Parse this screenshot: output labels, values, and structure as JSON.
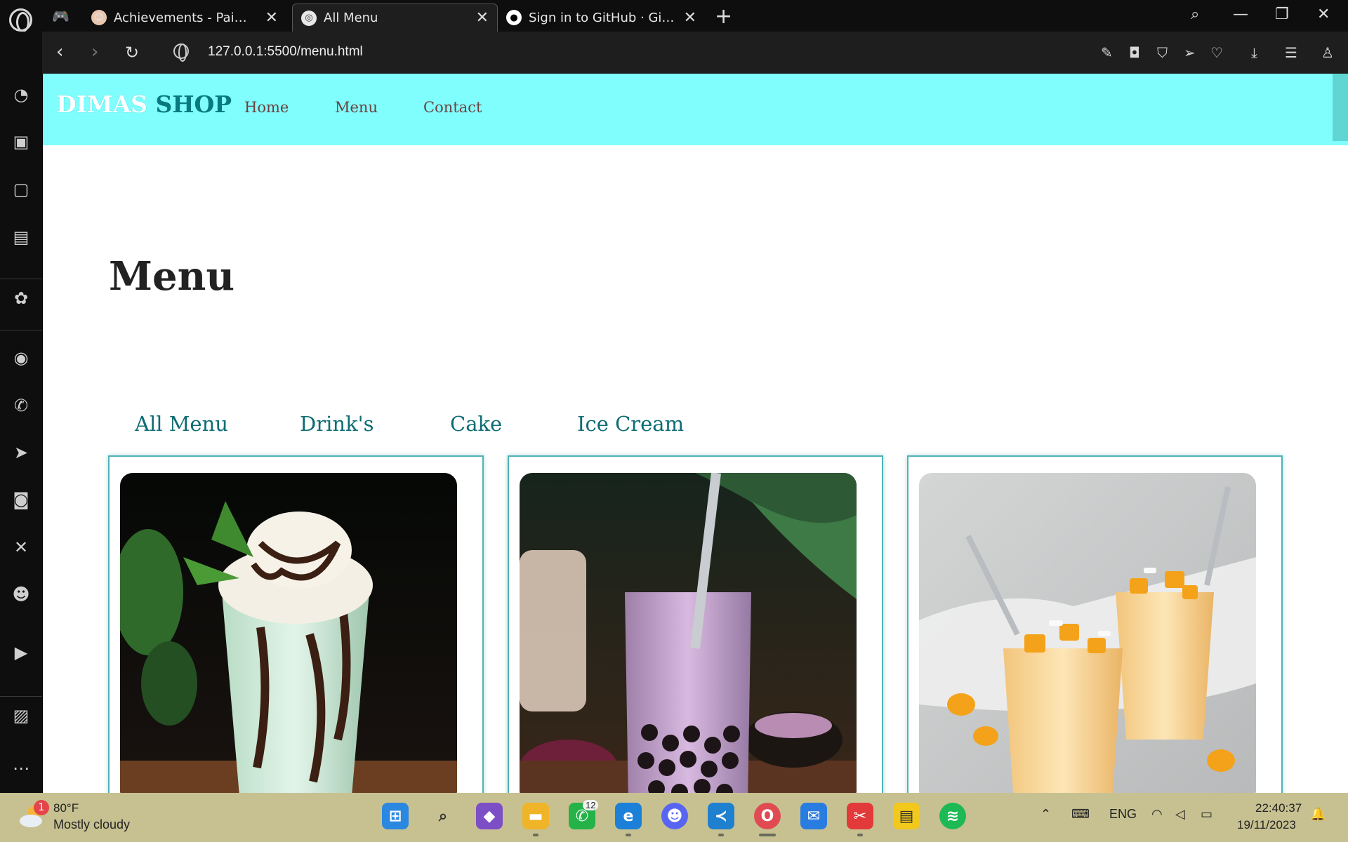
{
  "browser": {
    "tabs": [
      {
        "title": "Achievements - Paimon.moe",
        "active": false
      },
      {
        "title": "All Menu",
        "active": true
      },
      {
        "title": "Sign in to GitHub · GitHub",
        "active": false
      }
    ],
    "url": "127.0.0.1:5500/menu.html"
  },
  "site": {
    "brand_part1": "DIMAS",
    "brand_part2": "SHOP",
    "nav": [
      "Home",
      "Menu",
      "Contact"
    ],
    "page_title": "Menu",
    "categories": [
      "All Menu",
      "Drink's",
      "Cake",
      "Ice Cream"
    ],
    "accent_color": "#7ffefd",
    "brand_dark_color": "#08797e",
    "products": [
      {
        "image": "mint-chocolate-milkshake"
      },
      {
        "image": "taro-bubble-tea"
      },
      {
        "image": "mango-smoothies"
      }
    ]
  },
  "sidebar_icons": [
    "speed-dial-icon",
    "shop-icon",
    "twitch-icon",
    "cpu-icon",
    "chatgpt-icon",
    "messenger-icon",
    "whatsapp-icon",
    "telegram-icon",
    "instagram-icon",
    "x-icon",
    "discord-icon",
    "player-icon",
    "gallery-icon",
    "more-icon"
  ],
  "taskbar": {
    "weather_temp": "80°F",
    "weather_desc": "Mostly cloudy",
    "weather_badge": "1",
    "whatsapp_badge": "12",
    "language": "ENG",
    "time": "22:40:37",
    "date": "19/11/2023"
  }
}
